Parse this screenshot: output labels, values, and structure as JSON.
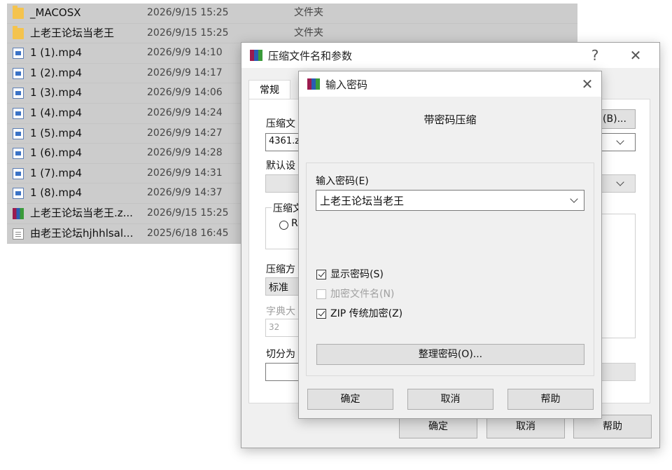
{
  "explorer": {
    "files": [
      {
        "name": "_MACOSX",
        "date": "2026/9/15 15:25",
        "type": "文件夹",
        "icon": "folder-icon"
      },
      {
        "name": "上老王论坛当老王",
        "date": "2026/9/15 15:25",
        "type": "文件夹",
        "icon": "folder-icon"
      },
      {
        "name": "1 (1).mp4",
        "date": "2026/9/9 14:10",
        "type": "",
        "icon": "video-file-icon"
      },
      {
        "name": "1 (2).mp4",
        "date": "2026/9/9 14:17",
        "type": "",
        "icon": "video-file-icon"
      },
      {
        "name": "1 (3).mp4",
        "date": "2026/9/9 14:06",
        "type": "",
        "icon": "video-file-icon"
      },
      {
        "name": "1 (4).mp4",
        "date": "2026/9/9 14:24",
        "type": "",
        "icon": "video-file-icon"
      },
      {
        "name": "1 (5).mp4",
        "date": "2026/9/9 14:27",
        "type": "",
        "icon": "video-file-icon"
      },
      {
        "name": "1 (6).mp4",
        "date": "2026/9/9 14:28",
        "type": "",
        "icon": "video-file-icon"
      },
      {
        "name": "1 (7).mp4",
        "date": "2026/9/9 14:31",
        "type": "",
        "icon": "video-file-icon"
      },
      {
        "name": "1 (8).mp4",
        "date": "2026/9/9 14:37",
        "type": "",
        "icon": "video-file-icon"
      },
      {
        "name": "上老王论坛当老王.z...",
        "date": "2026/9/15 15:25",
        "type": "",
        "icon": "winrar-archive-icon"
      },
      {
        "name": "由老王论坛hjhhlsal...",
        "date": "2025/6/18 16:45",
        "type": "",
        "icon": "text-file-icon"
      }
    ]
  },
  "archive_dialog": {
    "title": "压缩文件名和参数",
    "help_glyph": "?",
    "close_glyph": "✕",
    "tab_general": "常规",
    "archive_name_label": "压缩文",
    "archive_name_value": "4361.z",
    "browse_label": "(B)...",
    "default_profile_label": "默认设",
    "format_group_label": "压缩文",
    "format_radio_label": "R",
    "method_label": "压缩方",
    "method_value": "标准",
    "dict_label": "字典大",
    "dict_value": "32",
    "split_label": "切分为",
    "ok_label": "确定",
    "cancel_label": "取消",
    "help_label": "帮助"
  },
  "password_dialog": {
    "title": "输入密码",
    "close_glyph": "✕",
    "heading": "带密码压缩",
    "password_label": "输入密码(E)",
    "password_value": "上老王论坛当老王",
    "show_password_label": "显示密码(S)",
    "show_password_checked": true,
    "encrypt_names_label": "加密文件名(N)",
    "encrypt_names_checked": false,
    "zip_legacy_label": "ZIP 传统加密(Z)",
    "zip_legacy_checked": true,
    "organize_label": "整理密码(O)...",
    "ok_label": "确定",
    "cancel_label": "取消",
    "help_label": "帮助"
  },
  "colors": {
    "selection": "#cccccc",
    "dialog_bg": "#f0f0f0",
    "button_bg": "#e1e1e1",
    "folder": "#f4c34e"
  }
}
